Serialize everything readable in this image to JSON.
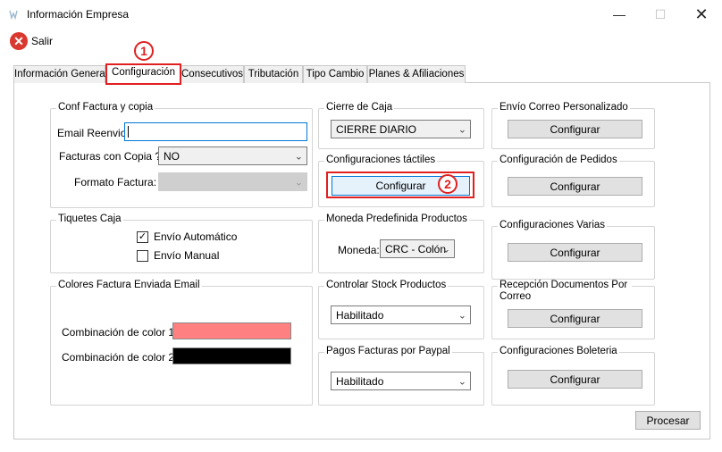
{
  "window": {
    "title": "Información Empresa",
    "minimize": "—",
    "maximize": "☐",
    "close": "✕"
  },
  "toolbar": {
    "exit_label": "Salir"
  },
  "tabs": [
    {
      "label": "Información General"
    },
    {
      "label": "Configuración"
    },
    {
      "label": "Consecutivos"
    },
    {
      "label": "Tributación"
    },
    {
      "label": "Tipo Cambio"
    },
    {
      "label": "Planes & Afiliaciones"
    }
  ],
  "annotations": {
    "one": "1",
    "two": "2"
  },
  "conf_factura": {
    "title": "Conf Factura y copia",
    "email_label": "Email Reenvio:",
    "email_value": "",
    "copy_label": "Facturas con Copia ?",
    "copy_value": "NO",
    "format_label": "Formato Factura:",
    "format_value": ""
  },
  "tiquetes": {
    "title": "Tiquetes Caja",
    "auto_label": "Envío Automático",
    "auto_checked": true,
    "manual_label": "Envío Manual",
    "manual_checked": false
  },
  "colores": {
    "title": "Colores Factura Enviada Email",
    "color1_label": "Combinación de color 1:",
    "color1": "#ff8080",
    "color2_label": "Combinación de color 2:",
    "color2": "#000000"
  },
  "cierre": {
    "title": "Cierre de Caja",
    "value": "CIERRE DIARIO"
  },
  "tactiles": {
    "title": "Configuraciones táctiles",
    "button": "Configurar"
  },
  "moneda": {
    "title": "Moneda Predefinida Productos",
    "label": "Moneda:",
    "value": "CRC - Colón"
  },
  "stock": {
    "title": "Controlar Stock Productos",
    "value": "Habilitado"
  },
  "paypal": {
    "title": "Pagos Facturas por Paypal",
    "value": "Habilitado"
  },
  "correo": {
    "title": "Envío Correo Personalizado",
    "button": "Configurar"
  },
  "pedidos": {
    "title": "Configuración de Pedidos",
    "button": "Configurar"
  },
  "varias": {
    "title": "Configuraciones Varias",
    "button": "Configurar"
  },
  "recepcion": {
    "title": "Recepción Documentos Por Correo",
    "button": "Configurar"
  },
  "boleteria": {
    "title": "Configuraciones Boleteria",
    "button": "Configurar"
  },
  "footer": {
    "process_label": "Procesar"
  },
  "check_glyph": "✓",
  "arrow_glyph": "⌄"
}
